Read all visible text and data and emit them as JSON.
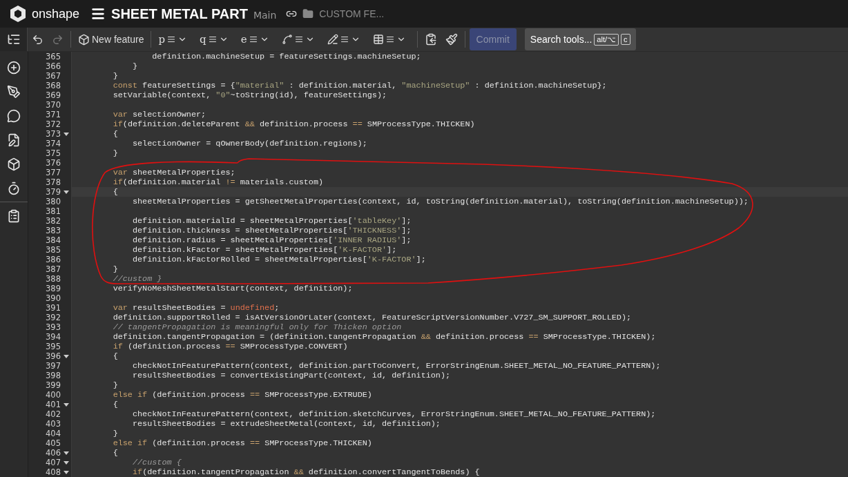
{
  "header": {
    "brand": "onshape",
    "document_title": "SHEET METAL PART",
    "branch": "Main",
    "folder": "CUSTOM FE..."
  },
  "toolbar": {
    "new_feature": "New feature",
    "undo_disabled": false,
    "redo_disabled": true,
    "tools": [
      {
        "glyph": "p"
      },
      {
        "glyph": "q"
      },
      {
        "glyph": "e"
      },
      {
        "kind": "curve"
      },
      {
        "kind": "pencil"
      },
      {
        "kind": "table"
      }
    ],
    "commit": {
      "label": "Commit",
      "disabled": true
    },
    "search": {
      "label": "Search tools...",
      "keys": [
        "alt/⌥",
        "c"
      ]
    }
  },
  "sidebar": {
    "feature_list_open": true
  },
  "editor": {
    "lines": [
      {
        "number": "365",
        "foldable": false,
        "current": false,
        "tokens": [
          {
            "kind": "plain",
            "text": "                definition.machineSetup = featureSettings.machineSetup;"
          }
        ]
      },
      {
        "number": "366",
        "foldable": false,
        "current": false,
        "tokens": [
          {
            "kind": "plain",
            "text": "            }"
          }
        ]
      },
      {
        "number": "367",
        "foldable": false,
        "current": false,
        "tokens": [
          {
            "kind": "plain",
            "text": "        }"
          }
        ]
      },
      {
        "number": "368",
        "foldable": false,
        "current": false,
        "tokens": [
          {
            "kind": "keyword",
            "text": "        const"
          },
          {
            "kind": "plain",
            "text": " featureSettings = {"
          },
          {
            "kind": "string",
            "text": "\"material\""
          },
          {
            "kind": "plain",
            "text": " : definition.material, "
          },
          {
            "kind": "string",
            "text": "\"machineSetup\""
          },
          {
            "kind": "plain",
            "text": " : definition.machineSetup};"
          }
        ]
      },
      {
        "number": "369",
        "foldable": false,
        "current": false,
        "tokens": [
          {
            "kind": "plain",
            "text": "        setVariable(context, "
          },
          {
            "kind": "string",
            "text": "\"0\""
          },
          {
            "kind": "plain",
            "text": "~toString(id), featureSettings);"
          }
        ]
      },
      {
        "number": "370",
        "foldable": false,
        "current": false
      },
      {
        "number": "371",
        "foldable": false,
        "current": false,
        "tokens": [
          {
            "kind": "keyword",
            "text": "        var"
          },
          {
            "kind": "plain",
            "text": " selectionOwner;"
          }
        ]
      },
      {
        "number": "372",
        "foldable": false,
        "current": false,
        "tokens": [
          {
            "kind": "keyword",
            "text": "        if"
          },
          {
            "kind": "plain",
            "text": "(definition.deleteParent "
          },
          {
            "kind": "operator",
            "text": "&&"
          },
          {
            "kind": "plain",
            "text": " definition.process "
          },
          {
            "kind": "operator",
            "text": "=="
          },
          {
            "kind": "plain",
            "text": " SMProcessType.THICKEN)"
          }
        ]
      },
      {
        "number": "373",
        "foldable": true,
        "current": false,
        "tokens": [
          {
            "kind": "plain",
            "text": "        {"
          }
        ]
      },
      {
        "number": "374",
        "foldable": false,
        "current": false,
        "tokens": [
          {
            "kind": "plain",
            "text": "            selectionOwner = qOwnerBody(definition.regions);"
          }
        ]
      },
      {
        "number": "375",
        "foldable": false,
        "current": false,
        "tokens": [
          {
            "kind": "plain",
            "text": "        }"
          }
        ]
      },
      {
        "number": "376",
        "foldable": false,
        "current": false
      },
      {
        "number": "377",
        "foldable": false,
        "current": false,
        "tokens": [
          {
            "kind": "keyword",
            "text": "        var"
          },
          {
            "kind": "plain",
            "text": " sheetMetalProperties;"
          }
        ]
      },
      {
        "number": "378",
        "foldable": false,
        "current": false,
        "tokens": [
          {
            "kind": "keyword",
            "text": "        if"
          },
          {
            "kind": "plain",
            "text": "(definition.material "
          },
          {
            "kind": "operator",
            "text": "!="
          },
          {
            "kind": "plain",
            "text": " materials.custom)"
          }
        ]
      },
      {
        "number": "379",
        "foldable": true,
        "current": true,
        "tokens": [
          {
            "kind": "plain",
            "text": "        {"
          }
        ]
      },
      {
        "number": "380",
        "foldable": false,
        "current": false,
        "tokens": [
          {
            "kind": "plain",
            "text": "            sheetMetalProperties = getSheetMetalProperties(context, id, toString(definition.material), toString(definition.machineSetup));"
          }
        ]
      },
      {
        "number": "381",
        "foldable": false,
        "current": false
      },
      {
        "number": "382",
        "foldable": false,
        "current": false,
        "tokens": [
          {
            "kind": "plain",
            "text": "            definition.materialId = sheetMetalProperties["
          },
          {
            "kind": "string",
            "text": "'tableKey'"
          },
          {
            "kind": "plain",
            "text": "];"
          }
        ]
      },
      {
        "number": "383",
        "foldable": false,
        "current": false,
        "tokens": [
          {
            "kind": "plain",
            "text": "            definition.thickness = sheetMetalProperties["
          },
          {
            "kind": "string",
            "text": "'THICKNESS'"
          },
          {
            "kind": "plain",
            "text": "];"
          }
        ]
      },
      {
        "number": "384",
        "foldable": false,
        "current": false,
        "tokens": [
          {
            "kind": "plain",
            "text": "            definition.radius = sheetMetalProperties["
          },
          {
            "kind": "string",
            "text": "'INNER RADIUS'"
          },
          {
            "kind": "plain",
            "text": "];"
          }
        ]
      },
      {
        "number": "385",
        "foldable": false,
        "current": false,
        "tokens": [
          {
            "kind": "plain",
            "text": "            definition.kFactor = sheetMetalProperties["
          },
          {
            "kind": "string",
            "text": "'K-FACTOR'"
          },
          {
            "kind": "plain",
            "text": "];"
          }
        ]
      },
      {
        "number": "386",
        "foldable": false,
        "current": false,
        "tokens": [
          {
            "kind": "plain",
            "text": "            definition.kFactorRolled = sheetMetalProperties["
          },
          {
            "kind": "string",
            "text": "'K-FACTOR'"
          },
          {
            "kind": "plain",
            "text": "];"
          }
        ]
      },
      {
        "number": "387",
        "foldable": false,
        "current": false,
        "tokens": [
          {
            "kind": "plain",
            "text": "        }"
          }
        ]
      },
      {
        "number": "388",
        "foldable": false,
        "current": false,
        "tokens": [
          {
            "kind": "comment",
            "text": "        //custom }"
          }
        ]
      },
      {
        "number": "389",
        "foldable": false,
        "current": false,
        "tokens": [
          {
            "kind": "plain",
            "text": "        verifyNoMeshSheetMetalStart(context, definition);"
          }
        ]
      },
      {
        "number": "390",
        "foldable": false,
        "current": false
      },
      {
        "number": "391",
        "foldable": false,
        "current": false,
        "tokens": [
          {
            "kind": "keyword",
            "text": "        var"
          },
          {
            "kind": "plain",
            "text": " resultSheetBodies = "
          },
          {
            "kind": "constant",
            "text": "undefined"
          },
          {
            "kind": "plain",
            "text": ";"
          }
        ]
      },
      {
        "number": "392",
        "foldable": false,
        "current": false,
        "tokens": [
          {
            "kind": "plain",
            "text": "        definition.supportRolled = isAtVersionOrLater(context, FeatureScriptVersionNumber.V727_SM_SUPPORT_ROLLED);"
          }
        ]
      },
      {
        "number": "393",
        "foldable": false,
        "current": false,
        "tokens": [
          {
            "kind": "comment",
            "text": "        // tangentPropagation is meaningful only for Thicken option"
          }
        ]
      },
      {
        "number": "394",
        "foldable": false,
        "current": false,
        "tokens": [
          {
            "kind": "plain",
            "text": "        definition.tangentPropagation = (definition.tangentPropagation "
          },
          {
            "kind": "operator",
            "text": "&&"
          },
          {
            "kind": "plain",
            "text": " definition.process "
          },
          {
            "kind": "operator",
            "text": "=="
          },
          {
            "kind": "plain",
            "text": " SMProcessType.THICKEN);"
          }
        ]
      },
      {
        "number": "395",
        "foldable": false,
        "current": false,
        "tokens": [
          {
            "kind": "keyword",
            "text": "        if"
          },
          {
            "kind": "plain",
            "text": " (definition.process "
          },
          {
            "kind": "operator",
            "text": "=="
          },
          {
            "kind": "plain",
            "text": " SMProcessType.CONVERT)"
          }
        ]
      },
      {
        "number": "396",
        "foldable": true,
        "current": false,
        "tokens": [
          {
            "kind": "plain",
            "text": "        {"
          }
        ]
      },
      {
        "number": "397",
        "foldable": false,
        "current": false,
        "tokens": [
          {
            "kind": "plain",
            "text": "            checkNotInFeaturePattern(context, definition.partToConvert, ErrorStringEnum.SHEET_METAL_NO_FEATURE_PATTERN);"
          }
        ]
      },
      {
        "number": "398",
        "foldable": false,
        "current": false,
        "tokens": [
          {
            "kind": "plain",
            "text": "            resultSheetBodies = convertExistingPart(context, id, definition);"
          }
        ]
      },
      {
        "number": "399",
        "foldable": false,
        "current": false,
        "tokens": [
          {
            "kind": "plain",
            "text": "        }"
          }
        ]
      },
      {
        "number": "400",
        "foldable": false,
        "current": false,
        "tokens": [
          {
            "kind": "keyword",
            "text": "        else if"
          },
          {
            "kind": "plain",
            "text": " (definition.process "
          },
          {
            "kind": "operator",
            "text": "=="
          },
          {
            "kind": "plain",
            "text": " SMProcessType.EXTRUDE)"
          }
        ]
      },
      {
        "number": "401",
        "foldable": true,
        "current": false,
        "tokens": [
          {
            "kind": "plain",
            "text": "        {"
          }
        ]
      },
      {
        "number": "402",
        "foldable": false,
        "current": false,
        "tokens": [
          {
            "kind": "plain",
            "text": "            checkNotInFeaturePattern(context, definition.sketchCurves, ErrorStringEnum.SHEET_METAL_NO_FEATURE_PATTERN);"
          }
        ]
      },
      {
        "number": "403",
        "foldable": false,
        "current": false,
        "tokens": [
          {
            "kind": "plain",
            "text": "            resultSheetBodies = extrudeSheetMetal(context, id, definition);"
          }
        ]
      },
      {
        "number": "404",
        "foldable": false,
        "current": false,
        "tokens": [
          {
            "kind": "plain",
            "text": "        }"
          }
        ]
      },
      {
        "number": "405",
        "foldable": false,
        "current": false,
        "tokens": [
          {
            "kind": "keyword",
            "text": "        else if"
          },
          {
            "kind": "plain",
            "text": " (definition.process "
          },
          {
            "kind": "operator",
            "text": "=="
          },
          {
            "kind": "plain",
            "text": " SMProcessType.THICKEN)"
          }
        ]
      },
      {
        "number": "406",
        "foldable": true,
        "current": false,
        "tokens": [
          {
            "kind": "plain",
            "text": "        {"
          }
        ]
      },
      {
        "number": "407",
        "foldable": true,
        "current": false,
        "tokens": [
          {
            "kind": "comment",
            "text": "            //custom {"
          }
        ]
      },
      {
        "number": "408",
        "foldable": true,
        "current": false,
        "tokens": [
          {
            "kind": "keyword",
            "text": "            if"
          },
          {
            "kind": "plain",
            "text": "(definition.tangentPropagation "
          },
          {
            "kind": "operator",
            "text": "&&"
          },
          {
            "kind": "plain",
            "text": " definition.convertTangentToBends) {"
          }
        ]
      }
    ]
  }
}
